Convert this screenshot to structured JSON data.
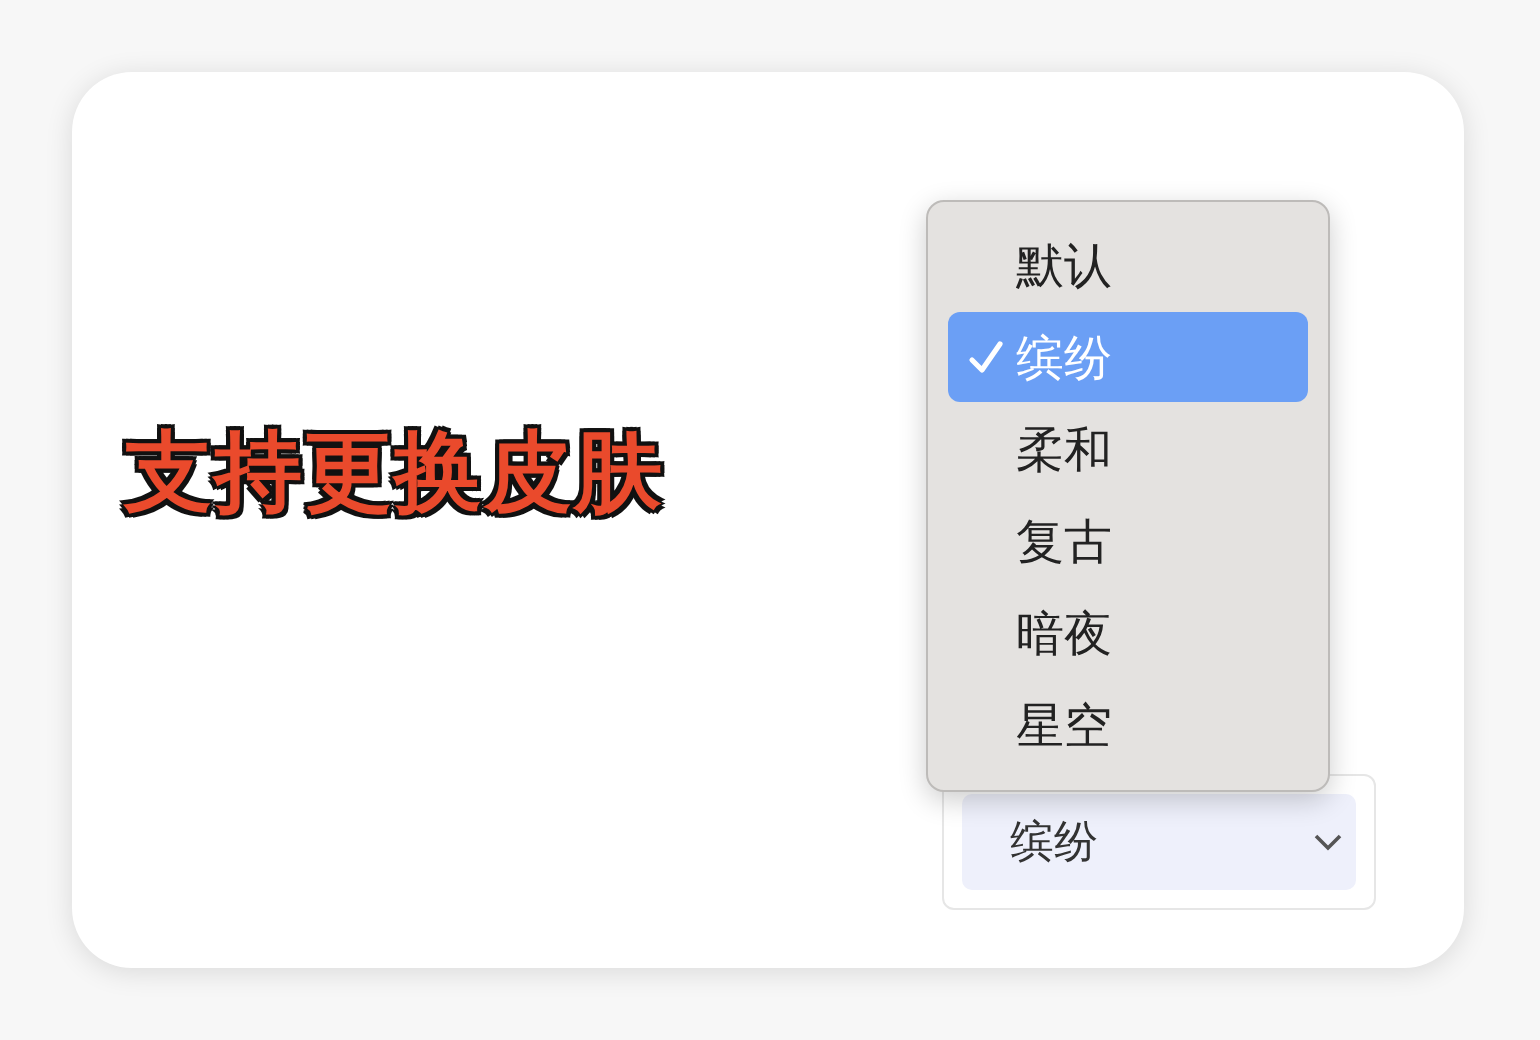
{
  "headline": "支持更换皮肤",
  "menu": {
    "options": [
      {
        "label": "默认",
        "selected": false
      },
      {
        "label": "缤纷",
        "selected": true
      },
      {
        "label": "柔和",
        "selected": false
      },
      {
        "label": "复古",
        "selected": false
      },
      {
        "label": "暗夜",
        "selected": false
      },
      {
        "label": "星空",
        "selected": false
      }
    ]
  },
  "select": {
    "value": "缤纷"
  }
}
